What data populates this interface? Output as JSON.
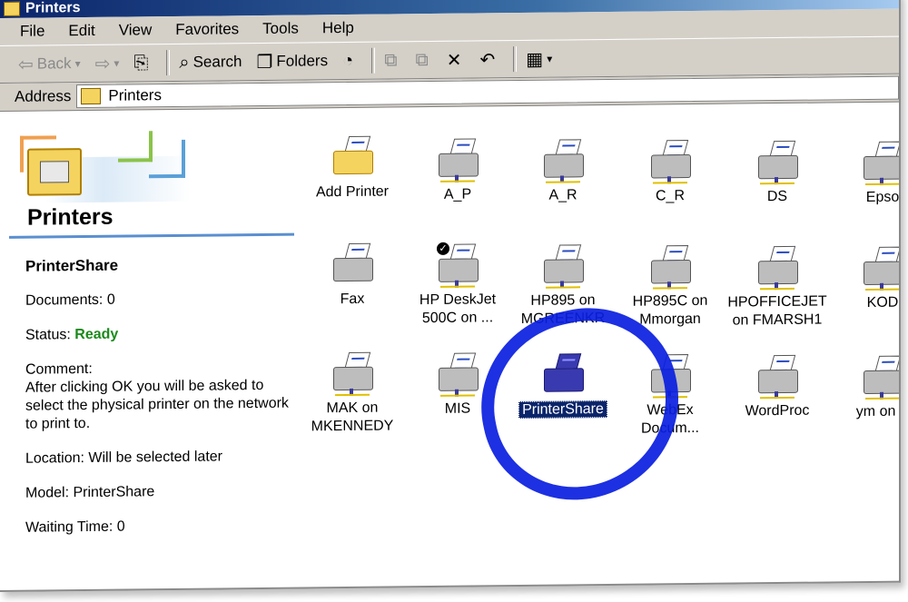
{
  "window": {
    "title": "Printers"
  },
  "menu": [
    "File",
    "Edit",
    "View",
    "Favorites",
    "Tools",
    "Help"
  ],
  "toolbar": {
    "back": "Back",
    "forward": "",
    "search": "Search",
    "folders": "Folders"
  },
  "address": {
    "label": "Address",
    "value": "Printers"
  },
  "left_panel": {
    "title": "Printers",
    "selected_name": "PrinterShare",
    "documents": "Documents: 0",
    "status_label": "Status:",
    "status_value": "Ready",
    "comment_label": "Comment:",
    "comment_text": "After clicking OK you will be asked to select the physical printer on the network to print to.",
    "location": "Location: Will be selected later",
    "model": "Model: PrinterShare",
    "waiting": "Waiting Time: 0"
  },
  "printers": [
    {
      "label": "Add Printer"
    },
    {
      "label": "A_P"
    },
    {
      "label": "A_R"
    },
    {
      "label": "C_R"
    },
    {
      "label": "DS"
    },
    {
      "label": "Epso"
    },
    {
      "label": "Fax"
    },
    {
      "label": "HP DeskJet 500C on ..."
    },
    {
      "label": "HP895 on MGREENKR"
    },
    {
      "label": "HP895C on Mmorgan"
    },
    {
      "label": "HPOFFICEJET on FMARSH1"
    },
    {
      "label": "KOD"
    },
    {
      "label": "MAK on MKENNEDY"
    },
    {
      "label": "MIS"
    },
    {
      "label": "PrinterShare"
    },
    {
      "label": "WebEx Docum..."
    },
    {
      "label": "WordProc"
    },
    {
      "label": "ym on Y"
    }
  ]
}
